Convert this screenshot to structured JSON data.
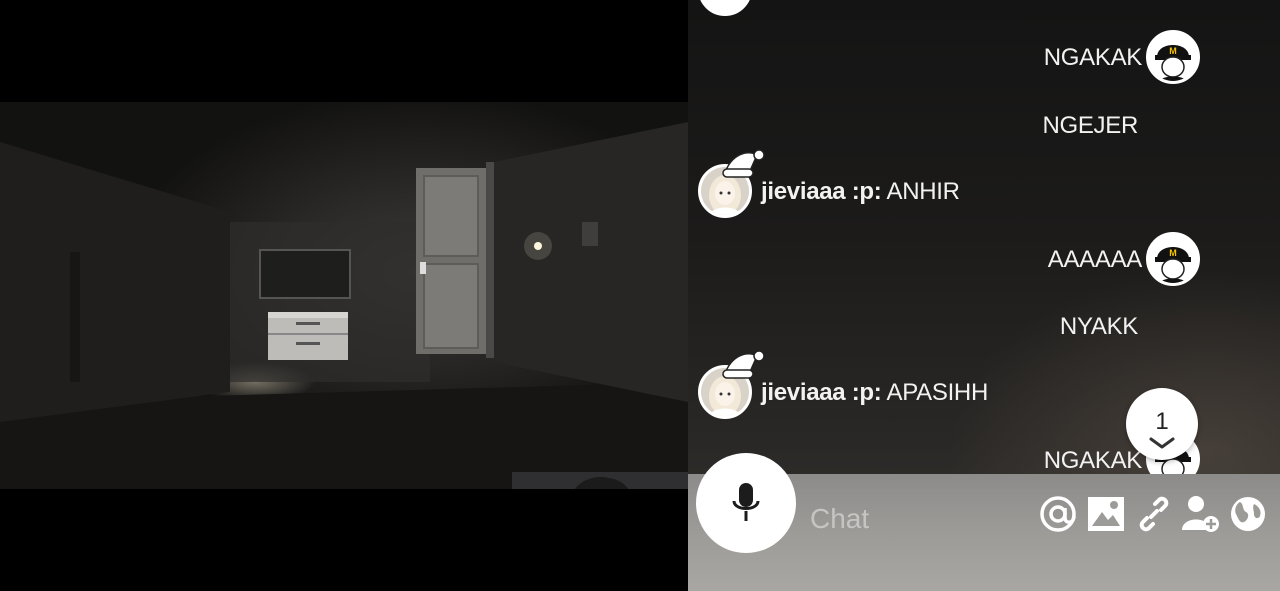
{
  "chat": {
    "messages": [
      {
        "side": "right",
        "text": "NGAKAK",
        "avatar": true
      },
      {
        "side": "right",
        "text": "NGEJER",
        "avatar": false
      },
      {
        "side": "left",
        "username": "jieviaaa :p:",
        "text": "ANHIR"
      },
      {
        "side": "right",
        "text": "AAAAAA",
        "avatar": true
      },
      {
        "side": "right",
        "text": "NYAKK",
        "avatar": false
      },
      {
        "side": "left",
        "username": "jieviaaa :p:",
        "text": "APASIHH"
      },
      {
        "side": "right",
        "text": "NGAKAK",
        "avatar": true
      }
    ],
    "unread_count": "1"
  },
  "input": {
    "placeholder": "Chat"
  },
  "toolbar": {
    "icons": [
      "at-icon",
      "image-icon",
      "link-icon",
      "add-user-icon",
      "globe-icon",
      "microphone-icon"
    ]
  },
  "colors": {
    "chat_text": "#f2f2f2",
    "input_bar": "#9d9b98"
  }
}
